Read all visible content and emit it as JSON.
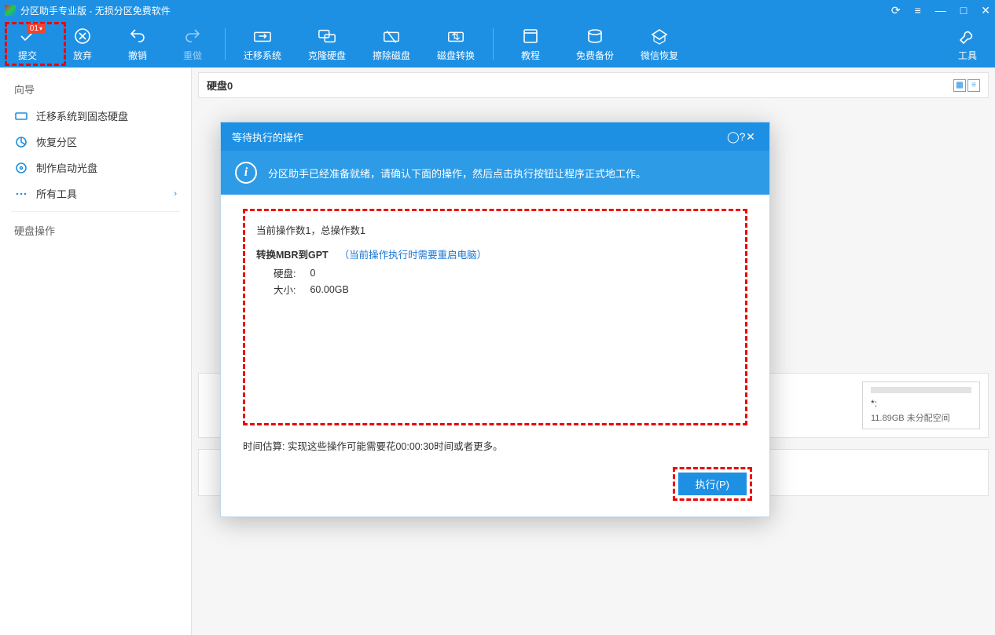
{
  "titlebar": {
    "app_name": "分区助手专业版",
    "subtitle": "无损分区免费软件"
  },
  "toolbar": {
    "submit": "提交",
    "submit_badge": "01",
    "discard": "放弃",
    "undo": "撤销",
    "redo": "重做",
    "migrate": "迁移系统",
    "clone": "克隆硬盘",
    "wipe": "擦除磁盘",
    "convert": "磁盘转换",
    "tutorial": "教程",
    "backup": "免费备份",
    "wechat": "微信恢复",
    "tools": "工具"
  },
  "sidebar": {
    "wizard_title": "向导",
    "items": [
      {
        "label": "迁移系统到固态硬盘"
      },
      {
        "label": "恢复分区"
      },
      {
        "label": "制作启动光盘"
      },
      {
        "label": "所有工具"
      }
    ],
    "disk_ops_title": "硬盘操作"
  },
  "content": {
    "disk_label": "硬盘0",
    "partition_right": {
      "name": "*:",
      "info": "11.89GB 未分配空间"
    }
  },
  "modal": {
    "title": "等待执行的操作",
    "info_text": "分区助手已经准备就绪，请确认下面的操作，然后点击执行按钮让程序正式地工作。",
    "op_count_text": "当前操作数1，总操作数1",
    "op_name": "转换MBR到GPT",
    "op_warn": "（当前操作执行时需要重启电脑）",
    "rows": [
      {
        "k": "硬盘:",
        "v": "0"
      },
      {
        "k": "大小:",
        "v": "60.00GB"
      }
    ],
    "time_text": "时间估算: 实现这些操作可能需要花00:00:30时间或者更多。",
    "exec_button": "执行(P)"
  }
}
